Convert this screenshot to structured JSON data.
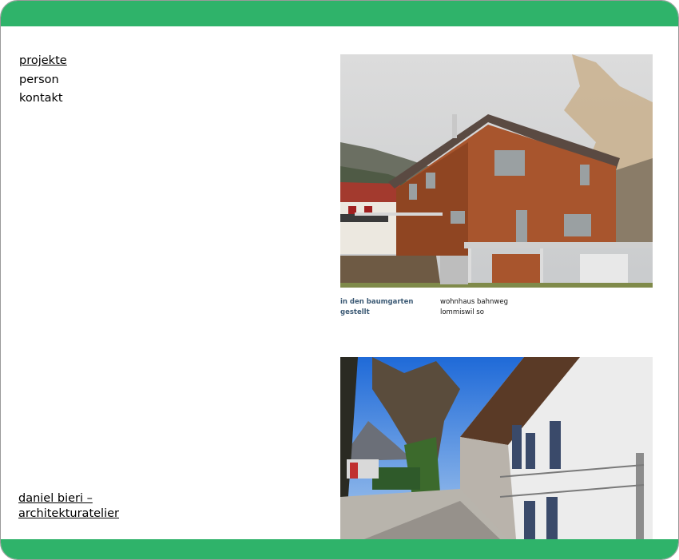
{
  "nav": {
    "items": [
      {
        "label": "projekte",
        "active": true
      },
      {
        "label": "person",
        "active": false
      },
      {
        "label": "kontakt",
        "active": false
      }
    ]
  },
  "footer": {
    "line1": "daniel bieri –",
    "line2": "architekturatelier"
  },
  "projects": [
    {
      "image_icon": "house-photo",
      "title": "in den baumgarten gestellt",
      "subtitle_line1": "wohnhaus bahnweg",
      "subtitle_line2": "lommiswil so"
    },
    {
      "image_icon": "courtyard-photo"
    }
  ],
  "colors": {
    "accent": "#2fb36a",
    "caption": "#3c5a75"
  }
}
